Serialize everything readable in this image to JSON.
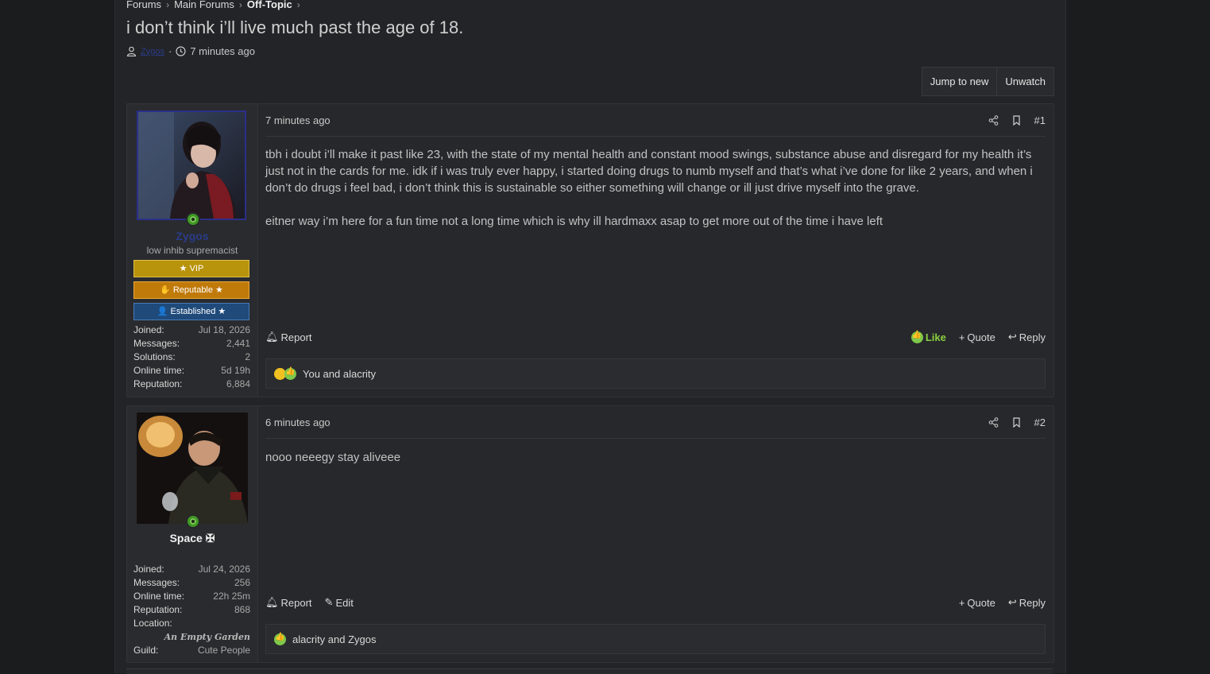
{
  "breadcrumb": [
    "Forums",
    "Main Forums",
    "Off-Topic"
  ],
  "thread": {
    "title": "i don’t think i’ll live much past the age of 18.",
    "author": "Zygos",
    "time": "7 minutes ago"
  },
  "buttons": {
    "jump": "Jump to new",
    "unwatch": "Unwatch"
  },
  "posts": [
    {
      "username": "Zygos",
      "user_title": "low inhib supremacist",
      "banners": [
        "VIP",
        "Reputable ★",
        "Established ★"
      ],
      "stats": [
        {
          "k": "Joined:",
          "v": "Jul 18, 2026"
        },
        {
          "k": "Messages:",
          "v": "2,441"
        },
        {
          "k": "Solutions:",
          "v": "2"
        },
        {
          "k": "Online time:",
          "v": "5d 19h"
        },
        {
          "k": "Reputation:",
          "v": "6,884"
        }
      ],
      "time": "7 minutes ago",
      "number": "#1",
      "paragraphs": [
        "tbh i doubt i’ll make it past like 23, with the state of my mental health and constant mood swings, substance abuse and disregard for my health it’s just not in the cards for me. idk if i was truly ever happy, i started doing drugs to numb myself and that’s what i’ve done for like 2 years, and when i don’t do drugs i feel bad, i don’t think this is sustainable so either something will change or ill just drive myself into the grave.",
        "eitner way i’m here for a fun time not a long time which is why ill hardmaxx asap to get more out of the time i have left"
      ],
      "report": "Report",
      "like": "Like",
      "quote": "Quote",
      "reply": "Reply",
      "reactions": "You and alacrity"
    },
    {
      "username": "Space ✠",
      "stats": [
        {
          "k": "Joined:",
          "v": "Jul 24, 2026"
        },
        {
          "k": "Messages:",
          "v": "256"
        },
        {
          "k": "Online time:",
          "v": "22h 25m"
        },
        {
          "k": "Reputation:",
          "v": "868"
        }
      ],
      "location_label": "Location:",
      "location": "An Empty Garden",
      "guild_label": "Guild:",
      "guild": "Cute People",
      "time": "6 minutes ago",
      "number": "#2",
      "paragraphs": [
        "nooo neeegy stay aliveee"
      ],
      "report": "Report",
      "edit": "Edit",
      "quote": "Quote",
      "reply": "Reply",
      "reactions": "alacrity and Zygos"
    }
  ],
  "colors": {
    "background": "#1b1c1e",
    "panel": "#27282b",
    "like_green": "#8ad040",
    "vip": "#b8930c",
    "reputable": "#c07a0a",
    "established": "#1f4a7a",
    "username_blue": "#2a3c8a"
  },
  "icons": [
    "chevron-right-icon",
    "user-icon",
    "clock-icon",
    "share-icon",
    "bookmark-icon",
    "bell-icon",
    "plus-icon",
    "reply-icon",
    "pencil-icon",
    "thumbs-up-icon",
    "star-icon",
    "handshake-icon"
  ]
}
